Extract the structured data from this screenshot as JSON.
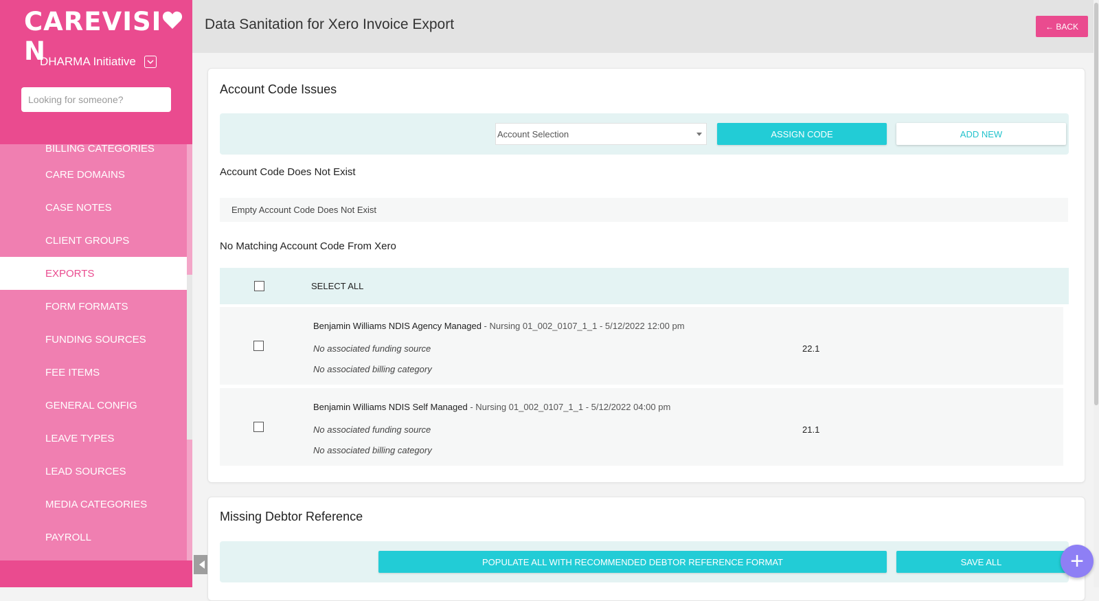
{
  "sidebar": {
    "brand_main": "CAREVISI",
    "brand_tail": "N",
    "org_name": "DHARMA Initiative",
    "search_placeholder": "Looking for someone?",
    "items": [
      {
        "label": "BILLING CATEGORIES"
      },
      {
        "label": "CARE DOMAINS"
      },
      {
        "label": "CASE NOTES"
      },
      {
        "label": "CLIENT GROUPS"
      },
      {
        "label": "EXPORTS"
      },
      {
        "label": "FORM FORMATS"
      },
      {
        "label": "FUNDING SOURCES"
      },
      {
        "label": "FEE ITEMS"
      },
      {
        "label": "GENERAL CONFIG"
      },
      {
        "label": "LEAVE TYPES"
      },
      {
        "label": "LEAD SOURCES"
      },
      {
        "label": "MEDIA CATEGORIES"
      },
      {
        "label": "PAYROLL"
      }
    ],
    "active_item": "EXPORTS"
  },
  "header": {
    "title": "Data Sanitation for Xero Invoice Export",
    "back_label": "← BACK"
  },
  "account_code": {
    "title": "Account Code Issues",
    "select_value": "Account Selection",
    "assign_label": "ASSIGN CODE",
    "add_new_label": "ADD NEW",
    "not_exist_heading": "Account Code Does Not Exist",
    "not_exist_empty": "Empty Account Code Does Not Exist",
    "no_match_heading": "No Matching Account Code From Xero",
    "select_all_label": "SELECT ALL",
    "rows": [
      {
        "client": "Benjamin Williams NDIS Agency Managed",
        "meta": " - Nursing 01_002_0107_1_1 - 5/12/2022 12:00 pm",
        "funding": "No associated funding source",
        "billing": "No associated billing category",
        "amount": "22.1"
      },
      {
        "client": "Benjamin Williams NDIS Self Managed",
        "meta": " - Nursing 01_002_0107_1_1 - 5/12/2022 04:00 pm",
        "funding": "No associated funding source",
        "billing": "No associated billing category",
        "amount": "21.1"
      }
    ]
  },
  "debtor": {
    "title": "Missing Debtor Reference",
    "populate_label": "POPULATE ALL WITH RECOMMENDED DEBTOR REFERENCE FORMAT",
    "save_all_label": "SAVE ALL"
  },
  "fab_symbol": "+",
  "colors": {
    "brand_pink": "#ea4b8f",
    "nav_pink": "#f07fb1",
    "teal": "#22ccd6",
    "toolbar_bg": "#e4f3f3",
    "fab_purple": "#8e7ff5"
  },
  "icons": [
    "heart-icon",
    "chevron-down-icon",
    "caret-down-icon",
    "checkbox-icon",
    "arrow-left-icon",
    "plus-icon"
  ]
}
